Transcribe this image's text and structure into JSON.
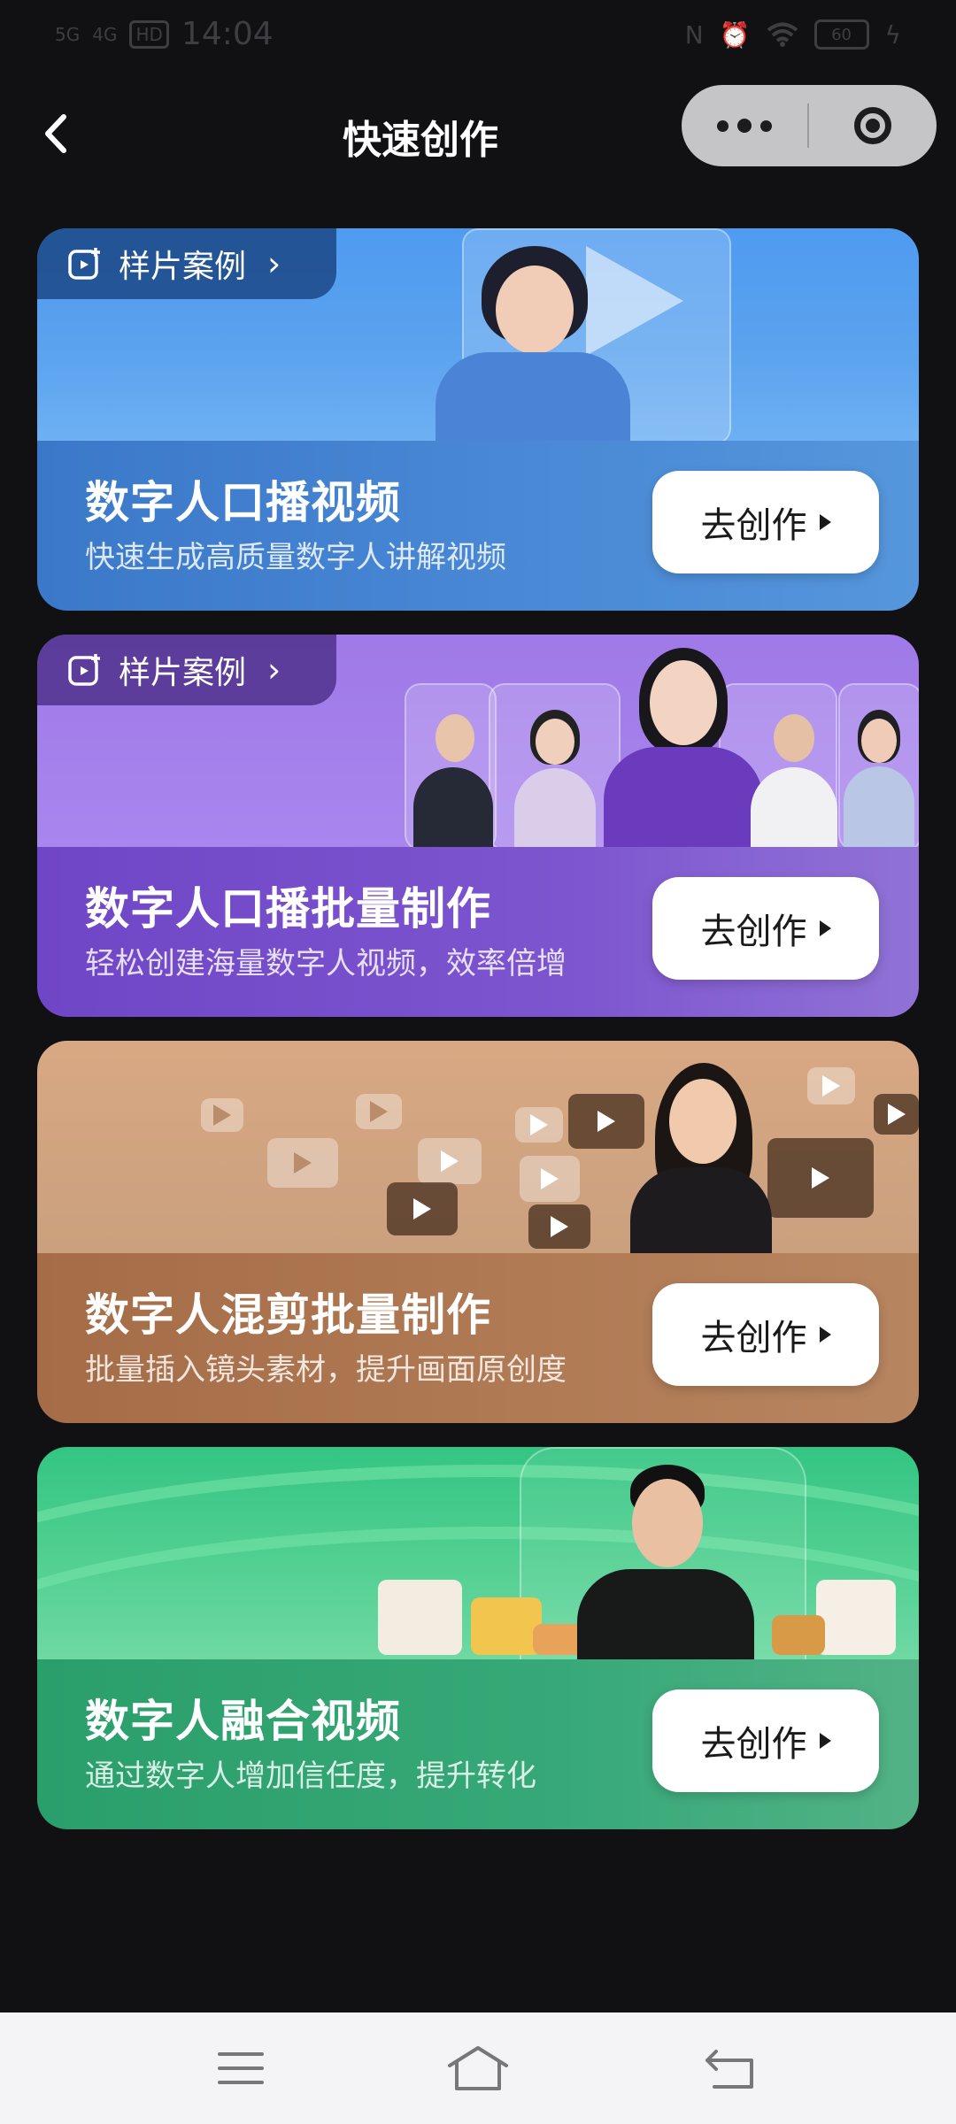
{
  "status_bar": {
    "time": "14:04",
    "network_1": "5G",
    "network_2": "4G",
    "hd_badge": "HD",
    "battery": "60"
  },
  "nav": {
    "title": "快速创作"
  },
  "sample_tag_label": "样片案例",
  "cards": [
    {
      "title": "数字人口播视频",
      "subtitle": "快速生成高质量数字人讲解视频",
      "button": "去创作",
      "has_sample_tag": true,
      "accent": "#4f9bf0"
    },
    {
      "title": "数字人口播批量制作",
      "subtitle": "轻松创建海量数字人视频，效率倍增",
      "button": "去创作",
      "has_sample_tag": true,
      "accent": "#9f7ae8"
    },
    {
      "title": "数字人混剪批量制作",
      "subtitle": "批量插入镜头素材，提升画面原创度",
      "button": "去创作",
      "has_sample_tag": false,
      "accent": "#d8a883"
    },
    {
      "title": "数字人融合视频",
      "subtitle": "通过数字人增加信任度，提升转化",
      "button": "去创作",
      "has_sample_tag": false,
      "accent": "#34c583"
    }
  ],
  "icons": {
    "back": "chevron-left-icon",
    "more": "more-dots-icon",
    "close": "target-close-icon",
    "sample": "video-add-icon",
    "menu": "menu-icon",
    "home": "home-icon",
    "return": "return-icon"
  }
}
